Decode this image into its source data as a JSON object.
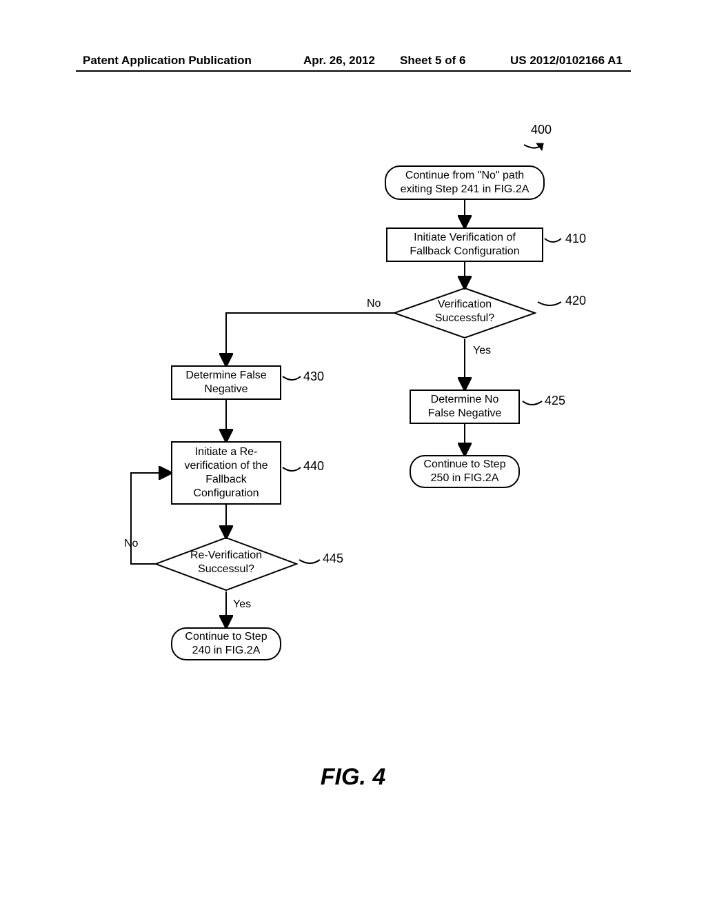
{
  "header": {
    "publication": "Patent Application Publication",
    "date": "Apr. 26, 2012",
    "sheet": "Sheet 5 of 6",
    "number": "US 2012/0102166 A1"
  },
  "figure_label": "FIG. 4",
  "overall_ref": "400",
  "nodes": {
    "start": "Continue from \"No\" path exiting Step 241 in FIG.2A",
    "s410": "Initiate Verification of Fallback Configuration",
    "d420": "Verification Successful?",
    "s425": "Determine No False Negative",
    "t425_cont": "Continue to Step 250 in FIG.2A",
    "s430": "Determine False Negative",
    "s440": "Initiate a Re-verification of the Fallback Configuration",
    "d445": "Re-Verification Successul?",
    "t_end": "Continue to Step 240 in FIG.2A"
  },
  "refs": {
    "r410": "410",
    "r420": "420",
    "r425": "425",
    "r430": "430",
    "r440": "440",
    "r445": "445"
  },
  "labels": {
    "yes": "Yes",
    "no": "No"
  }
}
